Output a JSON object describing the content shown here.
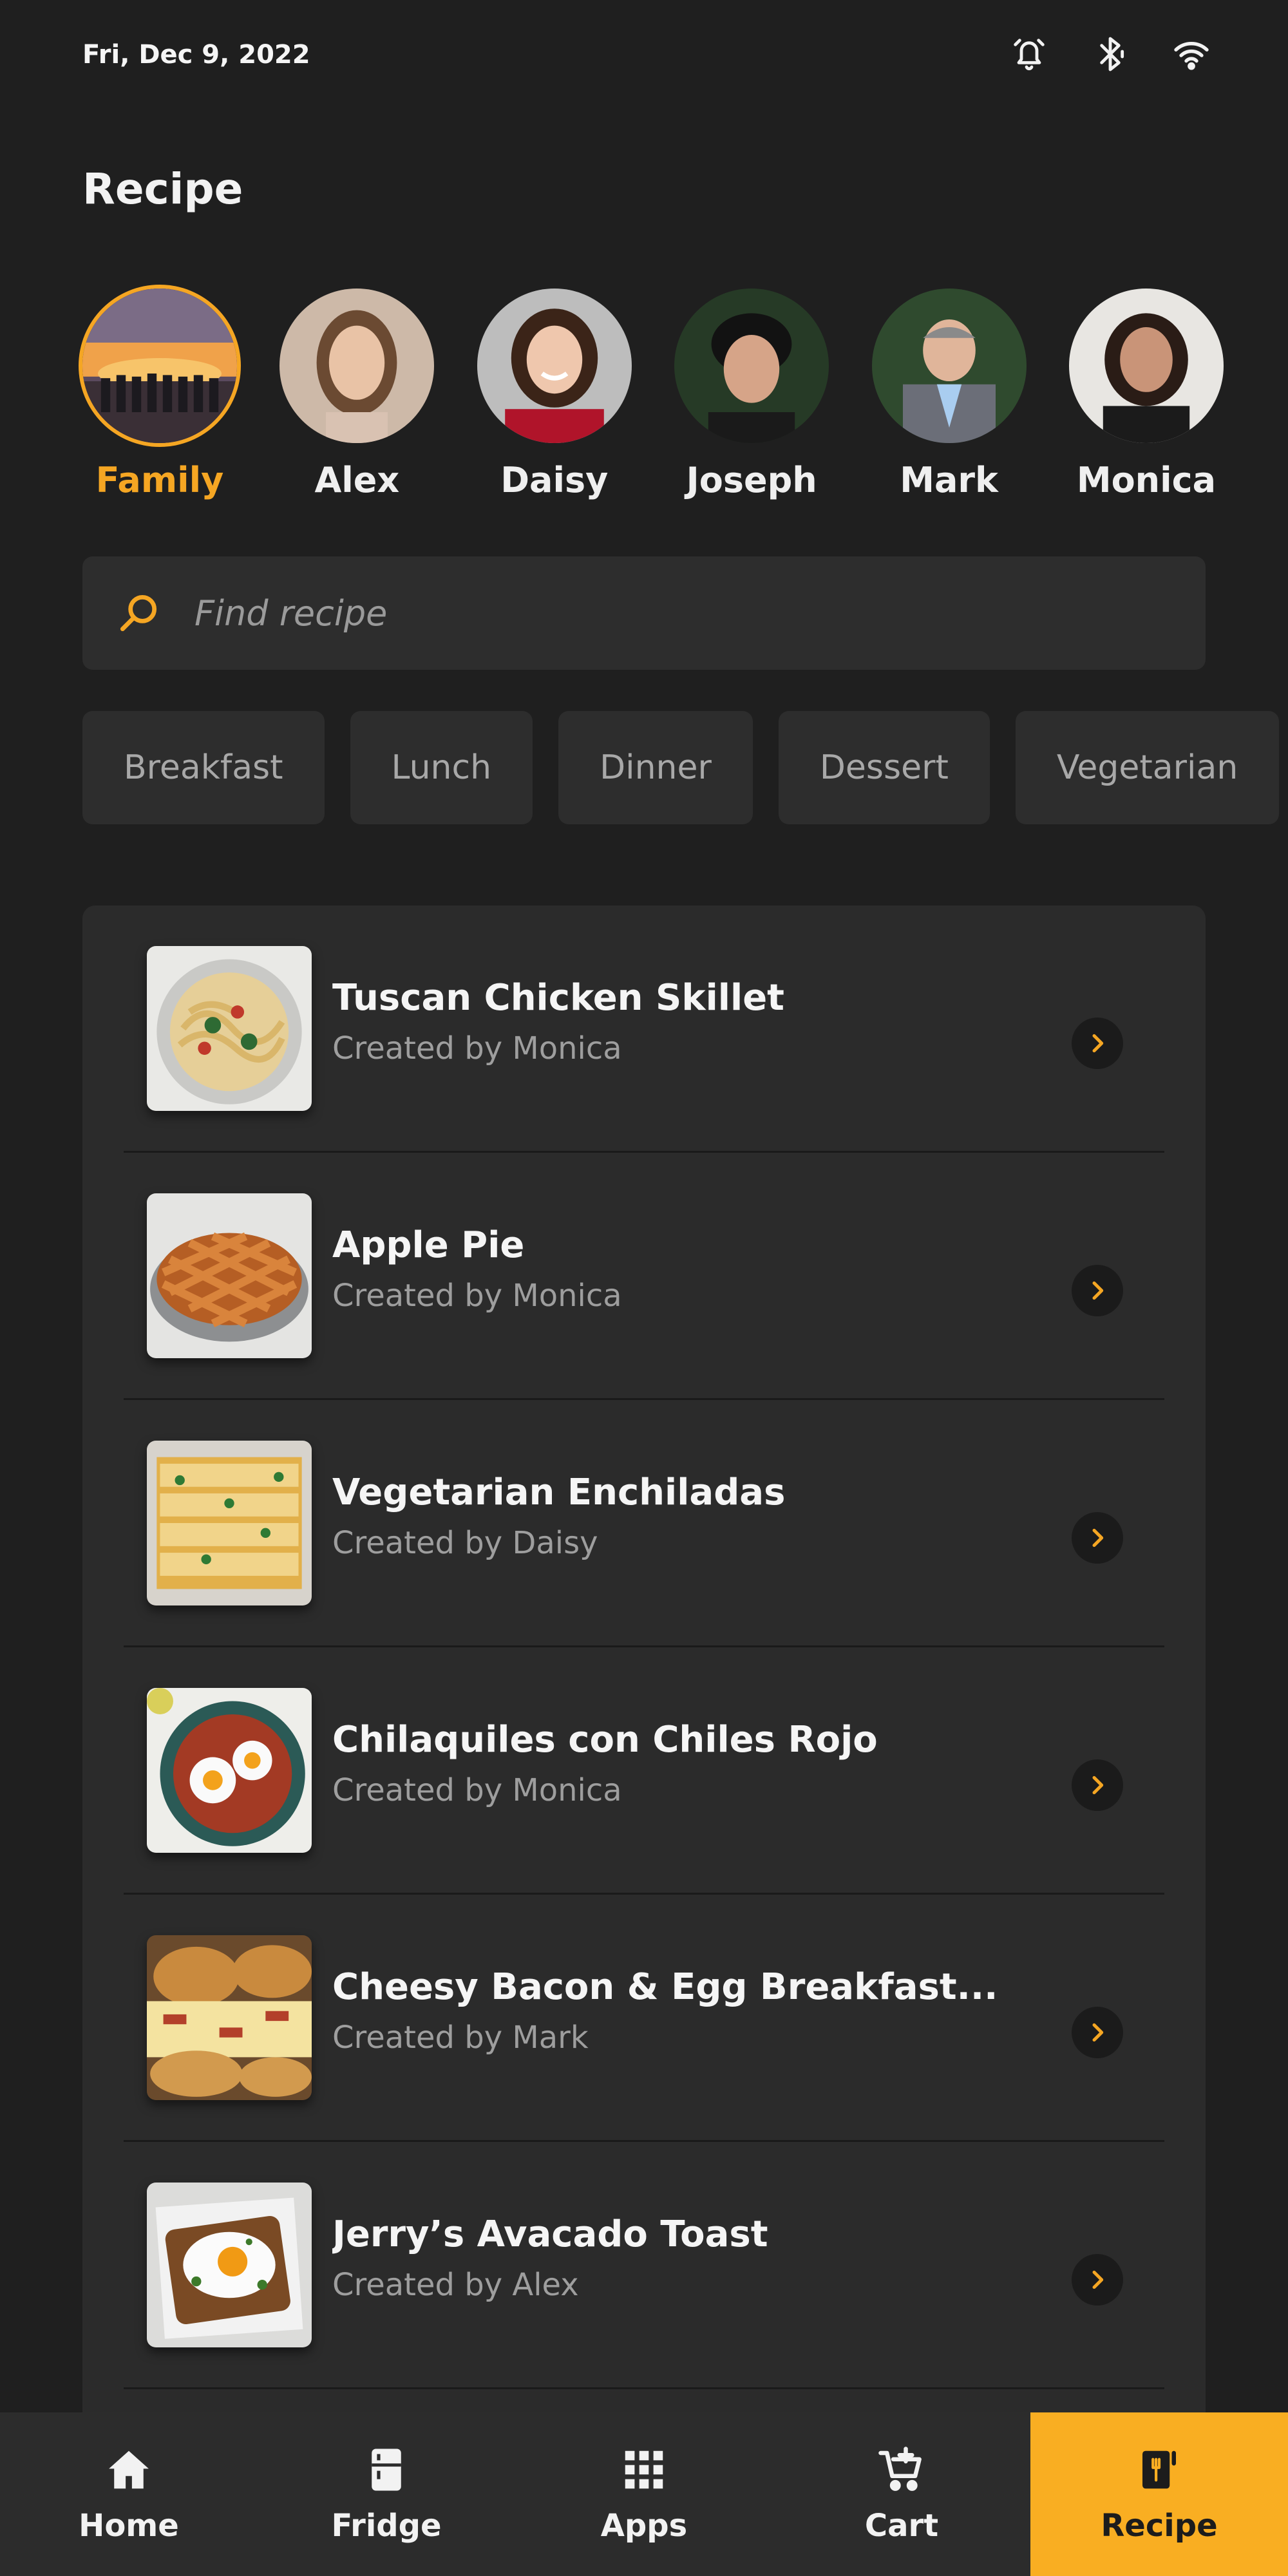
{
  "status_bar": {
    "date": "Fri, Dec 9, 2022",
    "icons": [
      "alarm-icon",
      "bluetooth-icon",
      "wifi-icon"
    ]
  },
  "page": {
    "title": "Recipe"
  },
  "profiles": [
    {
      "name": "Family",
      "selected": true
    },
    {
      "name": "Alex",
      "selected": false
    },
    {
      "name": "Daisy",
      "selected": false
    },
    {
      "name": "Joseph",
      "selected": false
    },
    {
      "name": "Mark",
      "selected": false
    },
    {
      "name": "Monica",
      "selected": false
    }
  ],
  "search": {
    "placeholder": "Find recipe",
    "value": ""
  },
  "categories": [
    "Breakfast",
    "Lunch",
    "Dinner",
    "Dessert",
    "Vegetarian"
  ],
  "recipes": [
    {
      "title": "Tuscan Chicken Skillet",
      "subtitle": "Created by Monica"
    },
    {
      "title": "Apple Pie",
      "subtitle": "Created by Monica"
    },
    {
      "title": "Vegetarian Enchiladas",
      "subtitle": "Created by Daisy"
    },
    {
      "title": "Chilaquiles con Chiles Rojo",
      "subtitle": "Created by Monica"
    },
    {
      "title": "Cheesy Bacon & Egg Breakfast...",
      "subtitle": "Created by Mark"
    },
    {
      "title": "Jerry’s Avacado Toast",
      "subtitle": "Created by Alex"
    }
  ],
  "bottom_nav": [
    {
      "label": "Home",
      "icon": "home-icon",
      "active": false
    },
    {
      "label": "Fridge",
      "icon": "fridge-icon",
      "active": false
    },
    {
      "label": "Apps",
      "icon": "apps-grid-icon",
      "active": false
    },
    {
      "label": "Cart",
      "icon": "cart-add-icon",
      "active": false
    },
    {
      "label": "Recipe",
      "icon": "recipe-icon",
      "active": true
    }
  ],
  "colors": {
    "accent": "#f9ae22",
    "background": "#1f1f1f",
    "surface": "#2b2b2b"
  }
}
